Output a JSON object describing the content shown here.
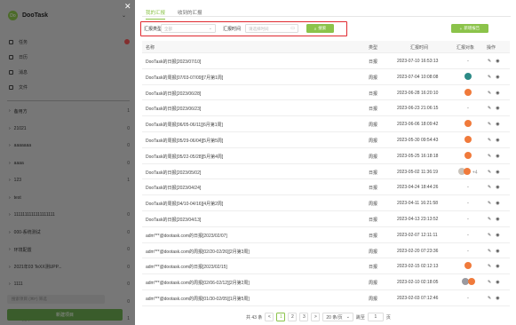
{
  "sidebar": {
    "brand": "DooTask",
    "logo_text": "Do",
    "items": [
      {
        "label": "任务",
        "count": "",
        "badge": true
      },
      {
        "label": "日历",
        "count": ""
      },
      {
        "label": "消息",
        "count": ""
      },
      {
        "label": "文件",
        "count": ""
      }
    ],
    "projects": [
      {
        "label": "备用方",
        "count": "1"
      },
      {
        "label": "21021",
        "count": "0"
      },
      {
        "label": "aaaaaaa",
        "count": "0"
      },
      {
        "label": "aaaa",
        "count": "0"
      },
      {
        "label": "123",
        "count": "1"
      },
      {
        "label": "test",
        "count": ""
      },
      {
        "label": "1111111111111111111",
        "count": "0"
      },
      {
        "label": "000-系统测试",
        "count": "0"
      },
      {
        "label": "环境配置",
        "count": "0"
      },
      {
        "label": "2021年03 TeXX测UPP...",
        "count": "0"
      },
      {
        "label": "1111",
        "count": "0"
      },
      {
        "label": "测试",
        "count": "0"
      },
      {
        "label": "test项目",
        "count": "1"
      }
    ],
    "search_placeholder": "搜索项目 (⌘F)  筛选",
    "new_button": "新建项目"
  },
  "drawer": {
    "tabs": [
      "我的汇报",
      "收到的汇报"
    ],
    "active_tab": 0,
    "filter": {
      "type_label": "汇报类型",
      "type_placeholder": "全部",
      "time_label": "汇报时间",
      "time_placeholder": "请选择时间",
      "search_button": "搜索"
    },
    "new_button": "新增报告",
    "columns": [
      "名称",
      "类型",
      "汇报时间",
      "汇报对象",
      "操作"
    ],
    "rows": [
      {
        "name": "DooTask的日报[2023/07/10]",
        "type": "日报",
        "time": "2023-07-10 16:53:13",
        "target": "-"
      },
      {
        "name": "DooTask的周报[07/03-07/09][7月第1周]",
        "type": "周报",
        "time": "2023-07-04 10:08:08",
        "target": "teal"
      },
      {
        "name": "DooTask的日报[2023/06/28]",
        "type": "日报",
        "time": "2023-06-28 16:20:10",
        "target": "orange"
      },
      {
        "name": "DooTask的日报[2023/06/23]",
        "type": "日报",
        "time": "2023-06-23 21:06:15",
        "target": "-"
      },
      {
        "name": "DooTask的周报[06/05-06/11][6月第1周]",
        "type": "周报",
        "time": "2023-06-06 18:09:42",
        "target": "orange"
      },
      {
        "name": "DooTask的周报[05/29-06/04][5月第5周]",
        "type": "周报",
        "time": "2023-05-30 09:54:43",
        "target": "orange"
      },
      {
        "name": "DooTask的周报[05/22-05/28][5月第4周]",
        "type": "周报",
        "time": "2023-05-25 16:18:18",
        "target": "orange"
      },
      {
        "name": "DooTask的日报[2023/05/02]",
        "type": "日报",
        "time": "2023-05-02 11:36:19",
        "target": "multi",
        "extra": "+4"
      },
      {
        "name": "DooTask的日报[2023/04/24]",
        "type": "日报",
        "time": "2023-04-24 18:44:26",
        "target": "-"
      },
      {
        "name": "DooTask的周报[04/10-04/16][4月第2周]",
        "type": "周报",
        "time": "2023-04-11 16:21:58",
        "target": "-"
      },
      {
        "name": "DooTask的日报[2023/04/13]",
        "type": "日报",
        "time": "2023-04-13 23:13:52",
        "target": "-"
      },
      {
        "name": "adm***@dootask.com的日报[2023/02/07]",
        "type": "日报",
        "time": "2023-02-07 12:11:11",
        "target": "-"
      },
      {
        "name": "adm***@dootask.com的周报[02/20-02/26][2月第3周]",
        "type": "周报",
        "time": "2023-02-20 07:23:36",
        "target": "-"
      },
      {
        "name": "adm***@dootask.com的日报[2023/02/15]",
        "type": "日报",
        "time": "2023-02-15 02:12:13",
        "target": "orange"
      },
      {
        "name": "adm***@dootask.com的周报[02/06-02/12][2月第2周]",
        "type": "周报",
        "time": "2023-02-10 02:18:05",
        "target": "pair"
      },
      {
        "name": "adm***@dootask.com的周报[01/30-02/05][1月第5周]",
        "type": "周报",
        "time": "2023-02-03 07:12:46",
        "target": "-"
      }
    ],
    "pagination": {
      "total": "共 43 条",
      "prev": "<",
      "pages": [
        "1",
        "2",
        "3"
      ],
      "current": "1",
      "next": ">",
      "page_size": "20 条/页",
      "goto_label": "跳至",
      "goto_value": "1",
      "page_unit": "页"
    }
  },
  "colors": {
    "accent": "#8bc34a",
    "highlight_border": "#e0282f"
  }
}
